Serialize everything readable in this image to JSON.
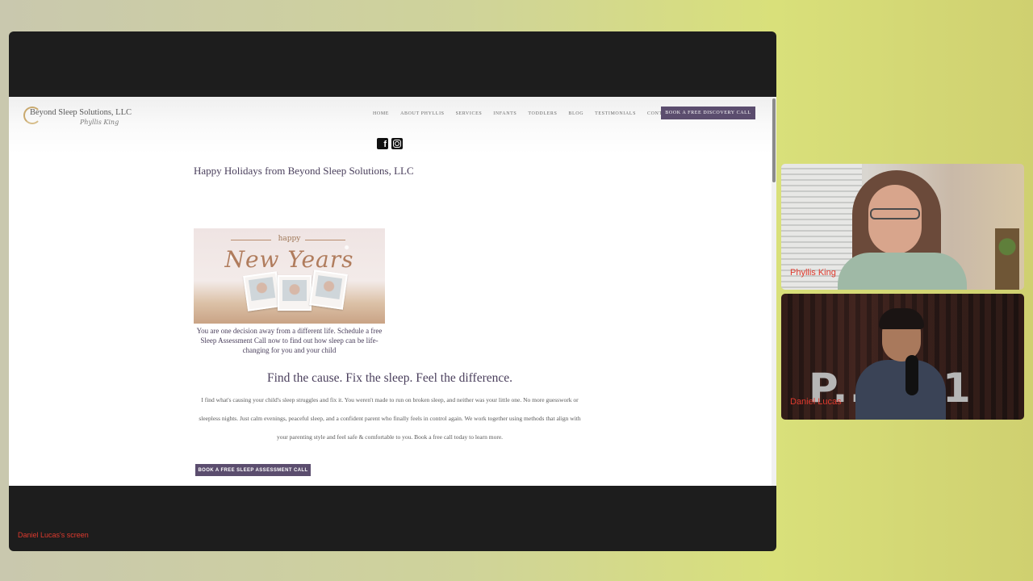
{
  "site": {
    "logo": {
      "name": "Beyond Sleep Solutions, LLC",
      "signature": "Phyllis King"
    },
    "nav": [
      {
        "label": "HOME"
      },
      {
        "label": "ABOUT PHYLLIS"
      },
      {
        "label": "SERVICES"
      },
      {
        "label": "INFANTS"
      },
      {
        "label": "TODDLERS"
      },
      {
        "label": "BLOG"
      },
      {
        "label": "TESTIMONIALS"
      },
      {
        "label": "CONTACT ME"
      }
    ],
    "header_cta": "BOOK A FREE DISCOVERY CALL",
    "social": [
      {
        "icon": "facebook-icon"
      },
      {
        "icon": "instagram-icon"
      }
    ]
  },
  "post": {
    "title": "Happy Holidays from Beyond Sleep Solutions, LLC",
    "image": {
      "happy": "happy",
      "script": "New Years"
    },
    "caption": "You are one decision away from a different life. Schedule a free Sleep Assessment Call now to find out how sleep can be life-changing for you and your child",
    "heading": "Find the cause. Fix the sleep. Feel the difference.",
    "body": "I find what's causing your child's sleep struggles and fix it.  You weren't made to run on broken sleep, and neither was your little one. No more guesswork or sleepless nights. Just calm evenings, peaceful sleep, and a confident parent who finally feels in control again. We work together using methods that align with your parenting style and feel safe & comfortable to you. Book a free call today to learn more.",
    "cta": "BOOK A FREE SLEEP ASSESSMENT CALL"
  },
  "meeting": {
    "presenter_label": "Daniel Lucas's screen",
    "participants": [
      {
        "name": "Phyllis King"
      },
      {
        "name": "Daniel Lucas",
        "background_text": "P...101"
      }
    ]
  },
  "colors": {
    "accent": "#5b4d6e",
    "name_label": "#e03a2e",
    "heading": "#4a3f5c"
  }
}
